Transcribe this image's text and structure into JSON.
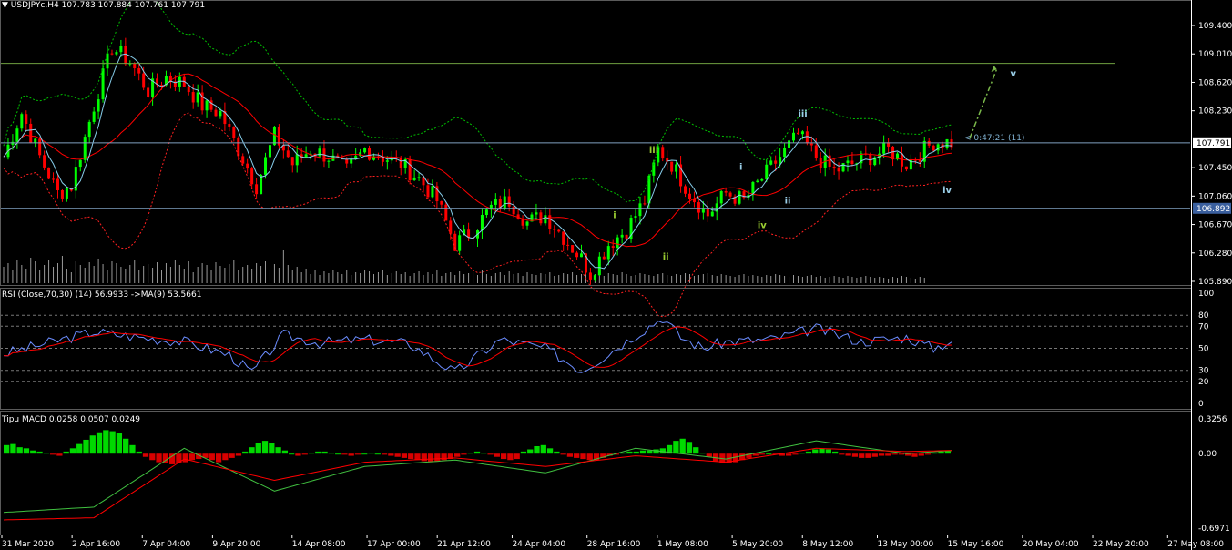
{
  "header": {
    "menu_glyph": "▼",
    "symbol": "USDJPYc,H4",
    "ohlc": "107.783 107.884 107.761 107.791"
  },
  "rsi_header": "RSI (Close,70,30) (14) 56.9933  ->MA(9) 53.5661",
  "macd_header": "Tipu MACD 0.0258 0.0507 0.0249",
  "countdown": "< 0:47:21 (11)",
  "colors": {
    "bull": "#00ff00",
    "bear": "#ff0000",
    "ma": "#ff0000",
    "fast_ma": "#87ceeb",
    "band": "#00c000",
    "band_low": "#ff2020",
    "hline_green": "#6fa040",
    "hline_blue": "#7fa0c0",
    "rsi_line": "#6b8cff",
    "rsi_ma": "#ff0000",
    "macd_signal": "#ff0000",
    "macd_line": "#40c040"
  },
  "chart_data": [
    {
      "type": "candlestick",
      "name": "main",
      "ylim": [
        105.89,
        109.6
      ],
      "y_ticks": [
        "109.400",
        "109.010",
        "108.620",
        "108.230",
        "107.450",
        "107.060",
        "106.670",
        "106.280",
        "105.890"
      ],
      "price_tags": [
        {
          "value": 107.791,
          "label": "107.791",
          "bg": "#ffffff",
          "fg": "#000000"
        },
        {
          "value": 106.892,
          "label": "106.892",
          "bg": "#3a5f9e",
          "fg": "#ffffff"
        }
      ],
      "hlines": [
        {
          "value": 108.88,
          "color": "hline_green"
        },
        {
          "value": 107.791,
          "color": "hline_blue"
        },
        {
          "value": 106.892,
          "color": "hline_blue"
        }
      ],
      "close_path": [
        [
          0,
          107.6
        ],
        [
          4,
          108.2
        ],
        [
          8,
          107.6
        ],
        [
          12,
          107.1
        ],
        [
          15,
          107.2
        ],
        [
          20,
          108.3
        ],
        [
          24,
          109.1
        ],
        [
          28,
          108.9
        ],
        [
          32,
          108.5
        ],
        [
          36,
          108.7
        ],
        [
          40,
          108.6
        ],
        [
          44,
          108.3
        ],
        [
          48,
          108.2
        ],
        [
          52,
          107.7
        ],
        [
          56,
          107.2
        ],
        [
          60,
          107.9
        ],
        [
          64,
          107.5
        ],
        [
          68,
          107.7
        ],
        [
          72,
          107.6
        ],
        [
          76,
          107.4
        ],
        [
          80,
          107.7
        ],
        [
          84,
          107.6
        ],
        [
          88,
          107.5
        ],
        [
          92,
          107.3
        ],
        [
          96,
          107.0
        ],
        [
          100,
          106.4
        ],
        [
          104,
          106.6
        ],
        [
          108,
          106.9
        ],
        [
          112,
          107.0
        ],
        [
          116,
          106.7
        ],
        [
          120,
          106.8
        ],
        [
          124,
          106.5
        ],
        [
          128,
          106.2
        ],
        [
          130,
          106.0
        ],
        [
          134,
          106.4
        ],
        [
          138,
          106.6
        ],
        [
          142,
          107.0
        ],
        [
          145,
          107.7
        ],
        [
          148,
          107.5
        ],
        [
          152,
          107.1
        ],
        [
          156,
          106.8
        ],
        [
          160,
          107.1
        ],
        [
          164,
          107.0
        ],
        [
          168,
          107.3
        ],
        [
          172,
          107.6
        ],
        [
          176,
          107.9
        ],
        [
          180,
          107.6
        ],
        [
          184,
          107.4
        ],
        [
          188,
          107.5
        ],
        [
          192,
          107.6
        ],
        [
          196,
          107.7
        ],
        [
          200,
          107.5
        ],
        [
          204,
          107.7
        ],
        [
          206,
          107.8
        ]
      ],
      "volume": [
        18,
        22,
        15,
        25,
        20,
        16,
        28,
        24,
        14,
        20,
        26,
        18,
        22,
        30,
        16,
        12,
        24,
        20,
        17,
        23,
        19,
        27,
        21,
        15,
        24,
        22,
        18,
        16,
        20,
        25,
        14,
        19,
        21,
        17,
        23,
        15,
        22,
        18,
        26,
        20,
        16,
        24,
        12,
        18,
        22,
        20,
        15,
        23,
        19,
        17,
        21,
        25,
        14,
        18,
        20,
        16,
        22,
        19,
        24,
        15,
        21,
        17,
        36,
        20,
        14,
        18,
        12,
        16,
        10,
        14,
        9,
        13,
        11,
        15,
        12,
        10,
        14,
        9,
        12,
        11,
        15,
        13,
        10,
        12,
        14,
        9,
        11,
        13,
        10,
        12,
        8,
        11,
        13,
        9,
        12,
        10,
        14,
        8,
        11,
        12,
        9,
        13,
        10,
        11,
        12,
        9,
        14,
        10,
        8,
        11,
        12,
        9,
        13,
        10,
        11,
        8,
        12,
        10,
        9,
        11,
        10,
        12,
        8,
        9,
        11,
        10,
        12,
        9,
        10,
        11,
        12,
        10,
        9,
        8,
        11,
        10,
        9,
        12,
        10,
        8,
        9,
        11,
        10,
        9,
        8,
        10,
        11,
        9,
        8,
        10,
        9,
        11,
        10,
        8,
        9,
        10,
        11,
        9,
        8,
        10,
        9,
        8,
        7,
        9,
        10,
        8,
        9,
        8,
        7,
        9,
        8,
        10,
        9,
        8,
        7,
        9,
        8,
        7,
        8,
        9,
        7,
        8,
        6,
        7,
        8,
        7,
        6,
        8,
        7,
        6,
        7,
        8,
        7,
        6,
        7,
        6,
        5,
        7,
        6,
        8,
        7,
        6,
        5,
        7,
        6
      ],
      "volume_max": 40,
      "wave_labels": [
        {
          "text": "iii",
          "x_index": 176,
          "value": 108.15,
          "color": "#9acfe8"
        },
        {
          "text": "iii",
          "x_index": 143,
          "value": 107.65,
          "color": "#9acd32"
        },
        {
          "text": "i",
          "x_index": 163,
          "value": 107.42,
          "color": "#9acfe8"
        },
        {
          "text": "ii",
          "x_index": 173,
          "value": 106.96,
          "color": "#9acfe8"
        },
        {
          "text": "iv",
          "x_index": 167,
          "value": 106.62,
          "color": "#9acd32"
        },
        {
          "text": "i",
          "x_index": 135,
          "value": 106.76,
          "color": "#9acd32"
        },
        {
          "text": "ii",
          "x_index": 146,
          "value": 106.19,
          "color": "#9acd32"
        },
        {
          "text": "iv",
          "x_index": 208,
          "value": 107.1,
          "color": "#9acfe8"
        },
        {
          "text": "v",
          "x_index": 223,
          "value": 108.7,
          "color": "#9acfe8"
        }
      ],
      "projection": {
        "from": [
          214,
          107.85
        ],
        "to": [
          220,
          108.8
        ],
        "color": "#7ab84a"
      }
    },
    {
      "type": "line",
      "name": "rsi",
      "ylim": [
        0,
        100
      ],
      "y_ticks": [
        100,
        80,
        70,
        50,
        30,
        20,
        0
      ],
      "levels": [
        80,
        70,
        50,
        30,
        20
      ],
      "x": [
        0,
        10,
        20,
        30,
        40,
        50,
        55,
        62,
        70,
        80,
        90,
        100,
        110,
        120,
        128,
        132,
        140,
        146,
        150,
        155,
        160,
        170,
        180,
        190,
        200,
        206,
        210
      ],
      "values": [
        45,
        55,
        65,
        60,
        56,
        44,
        28,
        62,
        55,
        58,
        54,
        28,
        58,
        50,
        30,
        40,
        62,
        78,
        60,
        50,
        56,
        58,
        68,
        56,
        60,
        50,
        57
      ]
    },
    {
      "type": "histogram",
      "name": "macd",
      "y_ticks": [
        "0.3256",
        "0.00",
        "-0.6971"
      ],
      "ylim": [
        -0.6971,
        0.3256
      ],
      "bars": [
        0.08,
        0.09,
        0.06,
        0.05,
        0.03,
        0.02,
        0.01,
        -0.01,
        -0.02,
        0.02,
        0.05,
        0.09,
        0.13,
        0.17,
        0.2,
        0.22,
        0.21,
        0.19,
        0.14,
        0.08,
        0.02,
        -0.03,
        -0.06,
        -0.08,
        -0.09,
        -0.1,
        -0.09,
        -0.08,
        -0.06,
        -0.05,
        -0.04,
        -0.06,
        -0.08,
        -0.06,
        -0.04,
        -0.02,
        0.02,
        0.06,
        0.1,
        0.12,
        0.1,
        0.06,
        0.03,
        0.0,
        -0.02,
        -0.01,
        0.01,
        0.02,
        0.02,
        0.01,
        0.0,
        -0.01,
        -0.02,
        -0.01,
        0.0,
        0.01,
        0.0,
        -0.01,
        -0.02,
        -0.03,
        -0.04,
        -0.05,
        -0.06,
        -0.07,
        -0.08,
        -0.07,
        -0.06,
        -0.05,
        -0.03,
        -0.01,
        0.01,
        0.02,
        0.01,
        -0.01,
        -0.03,
        -0.05,
        -0.06,
        -0.05,
        0.02,
        0.04,
        0.07,
        0.08,
        0.05,
        0.02,
        -0.01,
        -0.03,
        -0.04,
        -0.05,
        -0.06,
        -0.06,
        -0.04,
        -0.02,
        -0.01,
        0.01,
        0.02,
        0.02,
        0.03,
        0.03,
        0.04,
        0.05,
        0.08,
        0.12,
        0.14,
        0.11,
        0.06,
        0.01,
        -0.03,
        -0.07,
        -0.09,
        -0.09,
        -0.08,
        -0.06,
        -0.04,
        -0.02,
        -0.01,
        0.0,
        -0.01,
        -0.02,
        -0.02,
        -0.01,
        0.01,
        0.02,
        0.04,
        0.05,
        0.04,
        0.02,
        -0.01,
        -0.02,
        -0.03,
        -0.04,
        -0.04,
        -0.03,
        -0.02,
        -0.02,
        -0.01,
        -0.01,
        -0.02,
        -0.03,
        -0.02,
        -0.01,
        0.01,
        0.02,
        0.03
      ],
      "macd_line_x": [
        0,
        20,
        40,
        60,
        80,
        100,
        120,
        140,
        160,
        180,
        200,
        210
      ],
      "macd_line": [
        -0.55,
        -0.5,
        0.05,
        -0.35,
        -0.12,
        -0.06,
        -0.18,
        0.05,
        -0.05,
        0.12,
        0.0,
        0.03
      ],
      "signal_x": [
        0,
        20,
        40,
        60,
        80,
        100,
        120,
        140,
        160,
        180,
        200,
        210
      ],
      "signal": [
        -0.62,
        -0.6,
        -0.05,
        -0.25,
        -0.08,
        -0.04,
        -0.12,
        -0.02,
        -0.08,
        0.05,
        0.02,
        0.03
      ]
    }
  ],
  "x_axis": {
    "labels": [
      {
        "text": "31 Mar 2020",
        "x_index": 0
      },
      {
        "text": "2 Apr 16:00",
        "x_index": 15
      },
      {
        "text": "7 Apr 04:00",
        "x_index": 30
      },
      {
        "text": "9 Apr 20:00",
        "x_index": 45
      },
      {
        "text": "14 Apr 08:00",
        "x_index": 62
      },
      {
        "text": "17 Apr 00:00",
        "x_index": 78
      },
      {
        "text": "21 Apr 12:00",
        "x_index": 93
      },
      {
        "text": "24 Apr 04:00",
        "x_index": 109
      },
      {
        "text": "28 Apr 16:00",
        "x_index": 125
      },
      {
        "text": "1 May 08:00",
        "x_index": 140
      },
      {
        "text": "5 May 20:00",
        "x_index": 156
      },
      {
        "text": "8 May 12:00",
        "x_index": 171
      },
      {
        "text": "13 May 00:00",
        "x_index": 187
      },
      {
        "text": "15 May 16:00",
        "x_index": 202
      },
      {
        "text": "20 May 04:00",
        "x_index": 218
      },
      {
        "text": "22 May 20:00",
        "x_index": 233
      },
      {
        "text": "27 May 08:00",
        "x_index": 249
      }
    ]
  }
}
